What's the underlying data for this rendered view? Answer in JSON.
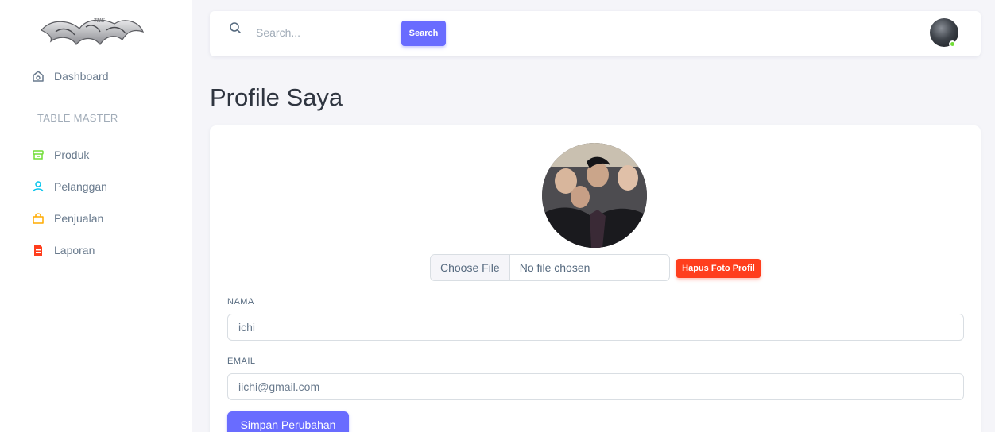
{
  "sidebar": {
    "logo_text": "THE PAINTERS",
    "items": [
      {
        "label": "Dashboard",
        "icon": "home-icon",
        "color": "#697a8d"
      },
      {
        "label": "Produk",
        "icon": "archive-icon",
        "color": "#71dd37"
      },
      {
        "label": "Pelanggan",
        "icon": "user-icon",
        "color": "#03c3ec"
      },
      {
        "label": "Penjualan",
        "icon": "shopping-bag-icon",
        "color": "#ffab00"
      },
      {
        "label": "Laporan",
        "icon": "file-icon",
        "color": "#ff3e1d"
      }
    ],
    "section_header": "TABLE MASTER"
  },
  "navbar": {
    "search_placeholder": "Search...",
    "search_button": "Search"
  },
  "page": {
    "title": "Profile Saya"
  },
  "profile": {
    "file_button": "Choose File",
    "file_status": "No file chosen",
    "delete_button": "Hapus Foto Profil",
    "name_label": "NAMA",
    "name_value": "ichi",
    "email_label": "EMAIL",
    "email_value": "iichi@gmail.com",
    "save_button": "Simpan Perubahan"
  },
  "colors": {
    "primary": "#696cff",
    "danger": "#ff3e1d",
    "online": "#71dd37"
  }
}
